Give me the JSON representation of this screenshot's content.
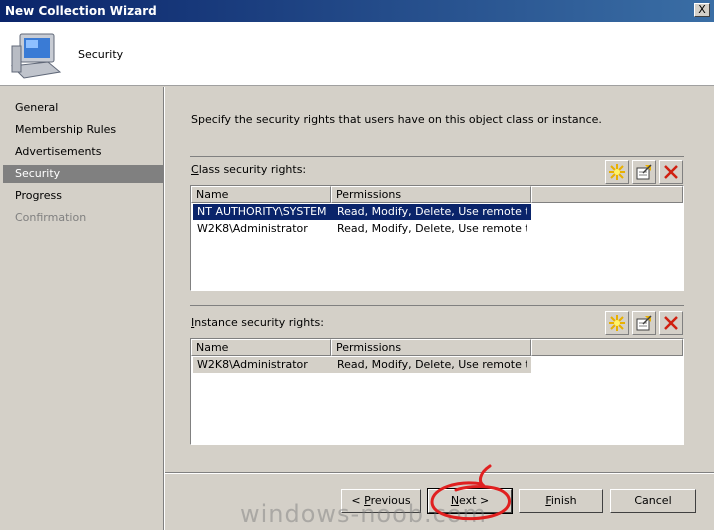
{
  "window": {
    "title": "New Collection Wizard",
    "close_label": "X"
  },
  "header": {
    "title": "Security",
    "icon": "computer-icon"
  },
  "nav": {
    "items": [
      {
        "label": "General",
        "state": "normal"
      },
      {
        "label": "Membership Rules",
        "state": "normal"
      },
      {
        "label": "Advertisements",
        "state": "normal"
      },
      {
        "label": "Security",
        "state": "selected"
      },
      {
        "label": "Progress",
        "state": "normal"
      },
      {
        "label": "Confirmation",
        "state": "disabled"
      }
    ]
  },
  "main": {
    "description": "Specify the security rights that users have on this object class or instance.",
    "class_rights": {
      "label_prefix": "C",
      "label_rest": "lass security rights:",
      "columns": [
        "Name",
        "Permissions"
      ],
      "rows": [
        {
          "name": "NT AUTHORITY\\SYSTEM",
          "permissions": "Read, Modify, Delete, Use remote t..."
        },
        {
          "name": "W2K8\\Administrator",
          "permissions": "Read, Modify, Delete, Use remote t..."
        }
      ]
    },
    "instance_rights": {
      "label_prefix": "I",
      "label_rest": "nstance security rights:",
      "columns": [
        "Name",
        "Permissions"
      ],
      "rows": [
        {
          "name": "W2K8\\Administrator",
          "permissions": "Read, Modify, Delete, Use remote t..."
        }
      ]
    }
  },
  "footer": {
    "previous_pre": "< ",
    "previous_ul": "P",
    "previous_post": "revious",
    "next_ul": "N",
    "next_post": "ext >",
    "finish_ul": "F",
    "finish_post": "inish",
    "cancel_label": "Cancel"
  },
  "watermark": "windows-noob.com",
  "colors": {
    "titlebar": "#0a246a",
    "selection": "#0a246a",
    "annotation": "#e02020"
  }
}
